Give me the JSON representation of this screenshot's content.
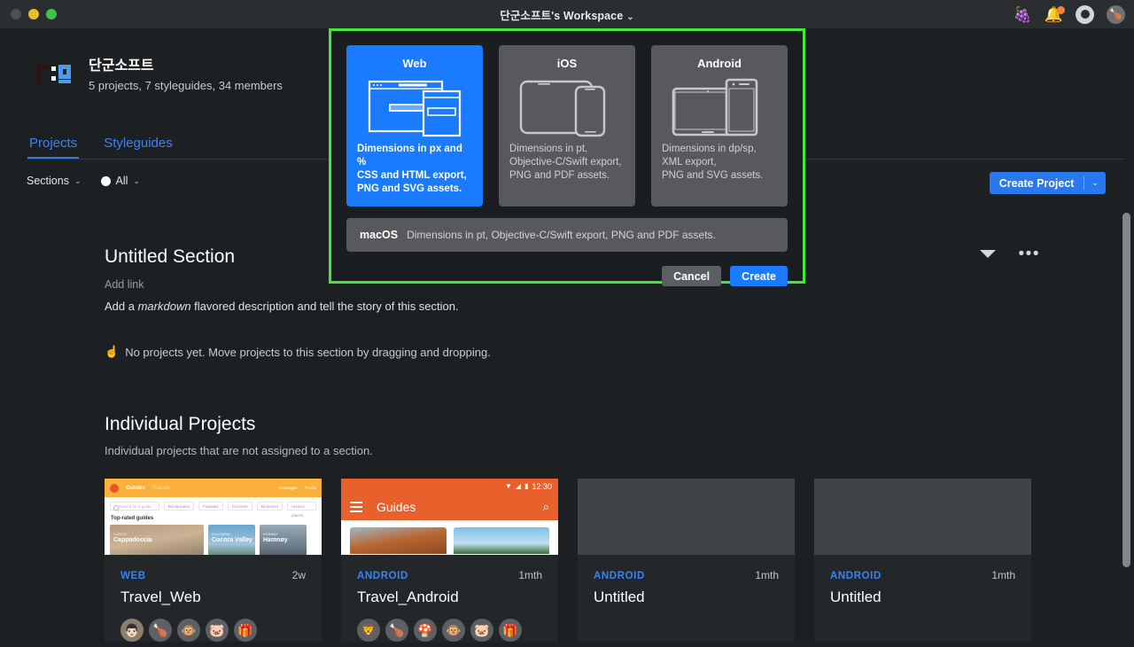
{
  "titlebar": {
    "window_title": "단군소프트's Workspace",
    "caret": "⌄",
    "icons": {
      "grapes": "🍇",
      "bell": "🔔",
      "help": "help-lifebuoy",
      "avatar": "🍗"
    }
  },
  "workspace": {
    "name": "단군소프트",
    "meta": "5 projects, 7 styleguides, 34 members"
  },
  "tabs": [
    {
      "label": "Projects",
      "active": true
    },
    {
      "label": "Styleguides",
      "active": false
    }
  ],
  "filters": {
    "sections_label": "Sections",
    "sections_caret": "⌄",
    "all_label": "All",
    "all_caret": "⌄"
  },
  "create_button": {
    "label": "Create Project",
    "caret": "⌄"
  },
  "section": {
    "title": "Untitled Section",
    "add_link": "Add link",
    "description_prefix": "Add a ",
    "description_em": "markdown",
    "description_suffix": " flavored description and tell the story of this section.",
    "empty_icon": "☝️",
    "empty_note": "No projects yet. Move projects to this section by dragging and dropping.",
    "collapse_icon": "triangle-down",
    "more_icon": "•••"
  },
  "individual": {
    "title": "Individual Projects",
    "description": "Individual projects that are not assigned to a section."
  },
  "projects": [
    {
      "kind": "WEB",
      "time": "2w",
      "name": "Travel_Web",
      "thumb": "web-guides",
      "members": [
        "👨🏻",
        "🍗",
        "🐵",
        "🐷",
        "🎁"
      ],
      "thumb_content": {
        "brand": "Guides",
        "nav": "Places",
        "nav_right": [
          "Messages",
          "Profile"
        ],
        "search_placeholder": "Search for a guide",
        "chips": [
          "Restaurants",
          "Festivals",
          "Concerts",
          "Museums",
          "Historic places"
        ],
        "section": "Top-rated guides",
        "cards": [
          {
            "country": "TURKEY",
            "name": "Cappadoccia"
          },
          {
            "country": "COLOMBIA",
            "name": "Cocora Valley"
          },
          {
            "country": "NORWAY",
            "name": "Hamnøy"
          }
        ]
      }
    },
    {
      "kind": "ANDROID",
      "time": "1mth",
      "name": "Travel_Android",
      "thumb": "android-guides",
      "members": [
        "🦁",
        "🍗",
        "🍄",
        "🐵",
        "🐷",
        "🎁"
      ],
      "thumb_content": {
        "status_time": "12:30",
        "title": "Guides"
      }
    },
    {
      "kind": "ANDROID",
      "time": "1mth",
      "name": "Untitled",
      "thumb": "blank",
      "members": []
    },
    {
      "kind": "ANDROID",
      "time": "1mth",
      "name": "Untitled",
      "thumb": "blank",
      "members": []
    }
  ],
  "modal": {
    "platforms": [
      {
        "name": "Web",
        "selected": true,
        "description": "Dimensions in px and %\nCSS and HTML export,\nPNG and SVG assets.",
        "icon": "browser-and-tablet"
      },
      {
        "name": "iOS",
        "selected": false,
        "description": "Dimensions in pt,\nObjective-C/Swift export,\nPNG and PDF assets.",
        "icon": "ipad-and-iphone"
      },
      {
        "name": "Android",
        "selected": false,
        "description": "Dimensions in dp/sp,\nXML export,\nPNG and SVG assets.",
        "icon": "android-tablet-and-phone"
      }
    ],
    "macos": {
      "name": "macOS",
      "description": "Dimensions in pt, Objective-C/Swift export, PNG and PDF assets."
    },
    "cancel_label": "Cancel",
    "create_label": "Create",
    "highlight_color": "#45e83a"
  },
  "colors": {
    "accent": "#2878ef",
    "selected_platform": "#1a7bff",
    "page_bg": "#1d2023",
    "titlebar_bg": "#2b2e31",
    "card_bg": "#24272a"
  }
}
